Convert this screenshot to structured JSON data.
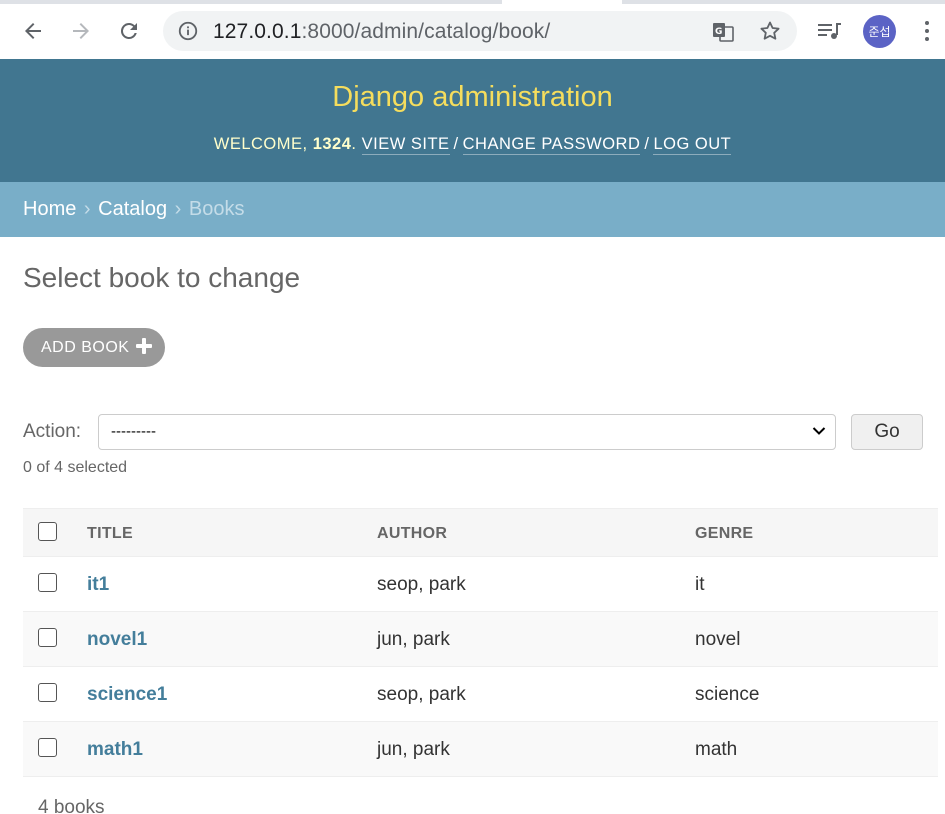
{
  "browser": {
    "url_host": "127.0.0.1",
    "url_rest": ":8000/admin/catalog/book/",
    "avatar_text": "준섭",
    "icons": [
      "back-icon",
      "forward-icon",
      "reload-icon",
      "info-icon",
      "translate-icon",
      "star-icon",
      "media-control-icon",
      "kebab-menu-icon"
    ]
  },
  "header": {
    "branding": "Django administration",
    "welcome": "WELCOME, ",
    "username": "1324",
    "welcome_end": ".",
    "view_site": "VIEW SITE",
    "change_password": "CHANGE PASSWORD",
    "log_out": "LOG OUT",
    "separator": "/"
  },
  "breadcrumbs": {
    "home": "Home",
    "catalog": "Catalog",
    "current": "Books",
    "arrow": "›"
  },
  "content": {
    "title": "Select book to change",
    "add_button": "ADD BOOK",
    "action_label": "Action:",
    "action_value": "---------",
    "go_button": "Go",
    "selected_count": "0 of 4 selected",
    "paginator": "4 books"
  },
  "table": {
    "headers": [
      "TITLE",
      "AUTHOR",
      "GENRE"
    ],
    "rows": [
      {
        "title": "it1",
        "author": "seop, park",
        "genre": "it"
      },
      {
        "title": "novel1",
        "author": "jun, park",
        "genre": "novel"
      },
      {
        "title": "science1",
        "author": "seop, park",
        "genre": "science"
      },
      {
        "title": "math1",
        "author": "jun, park",
        "genre": "math"
      }
    ]
  },
  "colors": {
    "header_bg": "#417690",
    "branding": "#f5dd5d",
    "breadcrumb_bg": "#79aec8",
    "link": "#447e9b",
    "add_button_bg": "#999999"
  }
}
